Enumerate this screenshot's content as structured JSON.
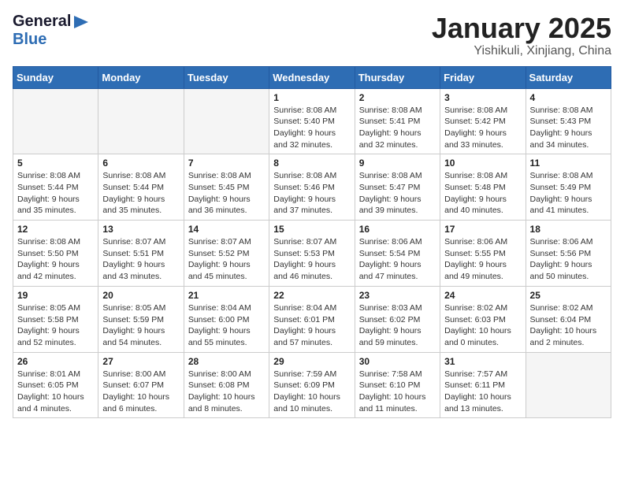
{
  "header": {
    "logo_general": "General",
    "logo_blue": "Blue",
    "month_title": "January 2025",
    "location": "Yishikuli, Xinjiang, China"
  },
  "calendar": {
    "days_of_week": [
      "Sunday",
      "Monday",
      "Tuesday",
      "Wednesday",
      "Thursday",
      "Friday",
      "Saturday"
    ],
    "weeks": [
      [
        {
          "day": "",
          "detail": ""
        },
        {
          "day": "",
          "detail": ""
        },
        {
          "day": "",
          "detail": ""
        },
        {
          "day": "1",
          "detail": "Sunrise: 8:08 AM\nSunset: 5:40 PM\nDaylight: 9 hours\nand 32 minutes."
        },
        {
          "day": "2",
          "detail": "Sunrise: 8:08 AM\nSunset: 5:41 PM\nDaylight: 9 hours\nand 32 minutes."
        },
        {
          "day": "3",
          "detail": "Sunrise: 8:08 AM\nSunset: 5:42 PM\nDaylight: 9 hours\nand 33 minutes."
        },
        {
          "day": "4",
          "detail": "Sunrise: 8:08 AM\nSunset: 5:43 PM\nDaylight: 9 hours\nand 34 minutes."
        }
      ],
      [
        {
          "day": "5",
          "detail": "Sunrise: 8:08 AM\nSunset: 5:44 PM\nDaylight: 9 hours\nand 35 minutes."
        },
        {
          "day": "6",
          "detail": "Sunrise: 8:08 AM\nSunset: 5:44 PM\nDaylight: 9 hours\nand 35 minutes."
        },
        {
          "day": "7",
          "detail": "Sunrise: 8:08 AM\nSunset: 5:45 PM\nDaylight: 9 hours\nand 36 minutes."
        },
        {
          "day": "8",
          "detail": "Sunrise: 8:08 AM\nSunset: 5:46 PM\nDaylight: 9 hours\nand 37 minutes."
        },
        {
          "day": "9",
          "detail": "Sunrise: 8:08 AM\nSunset: 5:47 PM\nDaylight: 9 hours\nand 39 minutes."
        },
        {
          "day": "10",
          "detail": "Sunrise: 8:08 AM\nSunset: 5:48 PM\nDaylight: 9 hours\nand 40 minutes."
        },
        {
          "day": "11",
          "detail": "Sunrise: 8:08 AM\nSunset: 5:49 PM\nDaylight: 9 hours\nand 41 minutes."
        }
      ],
      [
        {
          "day": "12",
          "detail": "Sunrise: 8:08 AM\nSunset: 5:50 PM\nDaylight: 9 hours\nand 42 minutes."
        },
        {
          "day": "13",
          "detail": "Sunrise: 8:07 AM\nSunset: 5:51 PM\nDaylight: 9 hours\nand 43 minutes."
        },
        {
          "day": "14",
          "detail": "Sunrise: 8:07 AM\nSunset: 5:52 PM\nDaylight: 9 hours\nand 45 minutes."
        },
        {
          "day": "15",
          "detail": "Sunrise: 8:07 AM\nSunset: 5:53 PM\nDaylight: 9 hours\nand 46 minutes."
        },
        {
          "day": "16",
          "detail": "Sunrise: 8:06 AM\nSunset: 5:54 PM\nDaylight: 9 hours\nand 47 minutes."
        },
        {
          "day": "17",
          "detail": "Sunrise: 8:06 AM\nSunset: 5:55 PM\nDaylight: 9 hours\nand 49 minutes."
        },
        {
          "day": "18",
          "detail": "Sunrise: 8:06 AM\nSunset: 5:56 PM\nDaylight: 9 hours\nand 50 minutes."
        }
      ],
      [
        {
          "day": "19",
          "detail": "Sunrise: 8:05 AM\nSunset: 5:58 PM\nDaylight: 9 hours\nand 52 minutes."
        },
        {
          "day": "20",
          "detail": "Sunrise: 8:05 AM\nSunset: 5:59 PM\nDaylight: 9 hours\nand 54 minutes."
        },
        {
          "day": "21",
          "detail": "Sunrise: 8:04 AM\nSunset: 6:00 PM\nDaylight: 9 hours\nand 55 minutes."
        },
        {
          "day": "22",
          "detail": "Sunrise: 8:04 AM\nSunset: 6:01 PM\nDaylight: 9 hours\nand 57 minutes."
        },
        {
          "day": "23",
          "detail": "Sunrise: 8:03 AM\nSunset: 6:02 PM\nDaylight: 9 hours\nand 59 minutes."
        },
        {
          "day": "24",
          "detail": "Sunrise: 8:02 AM\nSunset: 6:03 PM\nDaylight: 10 hours\nand 0 minutes."
        },
        {
          "day": "25",
          "detail": "Sunrise: 8:02 AM\nSunset: 6:04 PM\nDaylight: 10 hours\nand 2 minutes."
        }
      ],
      [
        {
          "day": "26",
          "detail": "Sunrise: 8:01 AM\nSunset: 6:05 PM\nDaylight: 10 hours\nand 4 minutes."
        },
        {
          "day": "27",
          "detail": "Sunrise: 8:00 AM\nSunset: 6:07 PM\nDaylight: 10 hours\nand 6 minutes."
        },
        {
          "day": "28",
          "detail": "Sunrise: 8:00 AM\nSunset: 6:08 PM\nDaylight: 10 hours\nand 8 minutes."
        },
        {
          "day": "29",
          "detail": "Sunrise: 7:59 AM\nSunset: 6:09 PM\nDaylight: 10 hours\nand 10 minutes."
        },
        {
          "day": "30",
          "detail": "Sunrise: 7:58 AM\nSunset: 6:10 PM\nDaylight: 10 hours\nand 11 minutes."
        },
        {
          "day": "31",
          "detail": "Sunrise: 7:57 AM\nSunset: 6:11 PM\nDaylight: 10 hours\nand 13 minutes."
        },
        {
          "day": "",
          "detail": ""
        }
      ]
    ]
  }
}
